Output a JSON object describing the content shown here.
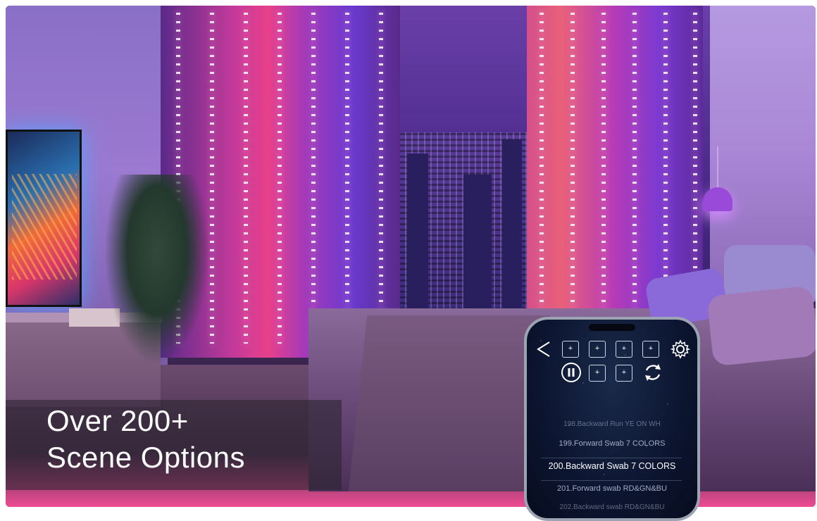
{
  "headline": {
    "line1": "Over 200+",
    "line2": "Scene Options"
  },
  "phone_app": {
    "back_label": "<",
    "mode_tiles": [
      "+",
      "+",
      "+",
      "+",
      "+",
      "+"
    ],
    "icons": {
      "back": "chevron-left-icon",
      "settings": "gear-icon",
      "play_pause": "pause-circle-icon",
      "cycle": "cycle-arrows-icon"
    },
    "scenes": [
      "198.Backward Run YE ON WH",
      "199.Forward Swab 7 COLORS",
      "200.Backward Swab 7 COLORS",
      "201.Forward swab RD&GN&BU",
      "202.Backward swab RD&GN&BU"
    ],
    "selected_scene": "200.Backward Swab 7 COLORS"
  },
  "colors": {
    "headline_text": "#ffffff",
    "app_background": "#0c1530",
    "curtain_pink": "#e8408a",
    "curtain_violet": "#6a3ad0"
  }
}
